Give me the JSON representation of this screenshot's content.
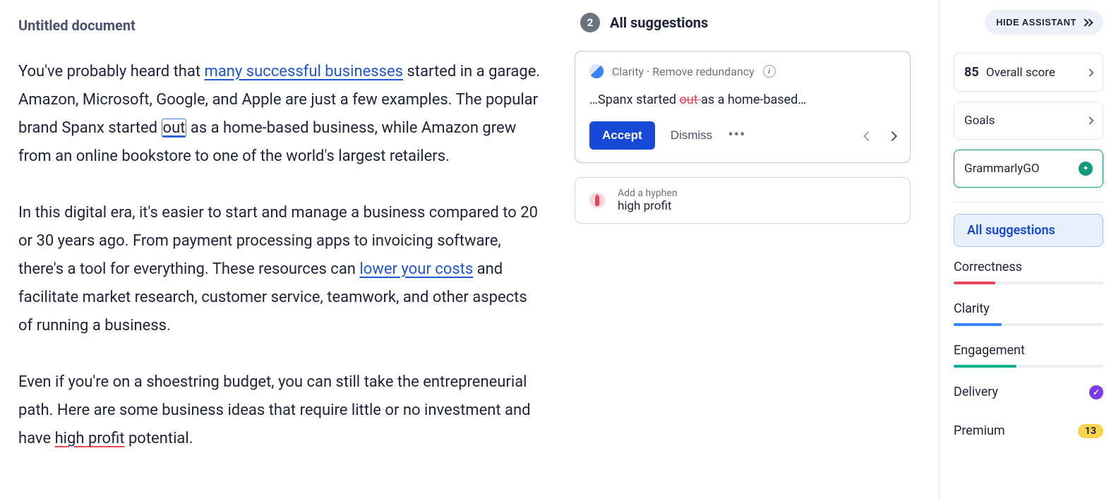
{
  "document": {
    "title": "Untitled document",
    "p1_a": "You've probably heard that ",
    "p1_link": "many successful businesses",
    "p1_b": " started in a garage. Amazon, Microsoft, Google, and Apple are just a few examples. The popular brand Spanx started ",
    "p1_highlight": "out",
    "p1_c": " as a home-based business, while Amazon grew from an online bookstore to one of the world's largest retailers.",
    "p2_a": "In this digital era, it's easier to start and manage a business compared to 20 or 30 years ago. From payment processing apps to invoicing software, there's a tool for everything. These resources can ",
    "p2_link": "lower your costs",
    "p2_b": " and facilitate market research, customer service, teamwork, and other aspects of running a business.",
    "p3_a": "Even if you're on a shoestring budget, you can still take the entrepreneurial path. Here are some business ideas that require little or no investment and have ",
    "p3_err": "high profit",
    "p3_b": " potential."
  },
  "suggestions": {
    "count": "2",
    "header": "All suggestions",
    "active": {
      "category": "Clarity · Remove redundancy",
      "preview_pre": "…Spanx started ",
      "preview_strike": "out ",
      "preview_post": "as a home-based…",
      "accept": "Accept",
      "dismiss": "Dismiss"
    },
    "collapsed": {
      "hint": "Add a hyphen",
      "text": "high profit"
    }
  },
  "sidebar": {
    "hide": "HIDE ASSISTANT",
    "score_num": "85",
    "score_label": "Overall score",
    "goals": "Goals",
    "go": "GrammarlyGO",
    "all": "All suggestions",
    "categories": {
      "correctness": {
        "label": "Correctness",
        "color": "#e8445a",
        "width": "28%"
      },
      "clarity": {
        "label": "Clarity",
        "color": "#3b82f6",
        "width": "32%"
      },
      "engagement": {
        "label": "Engagement",
        "color": "#10b091",
        "width": "42%"
      },
      "delivery": {
        "label": "Delivery"
      },
      "premium": {
        "label": "Premium",
        "count": "13"
      }
    }
  }
}
